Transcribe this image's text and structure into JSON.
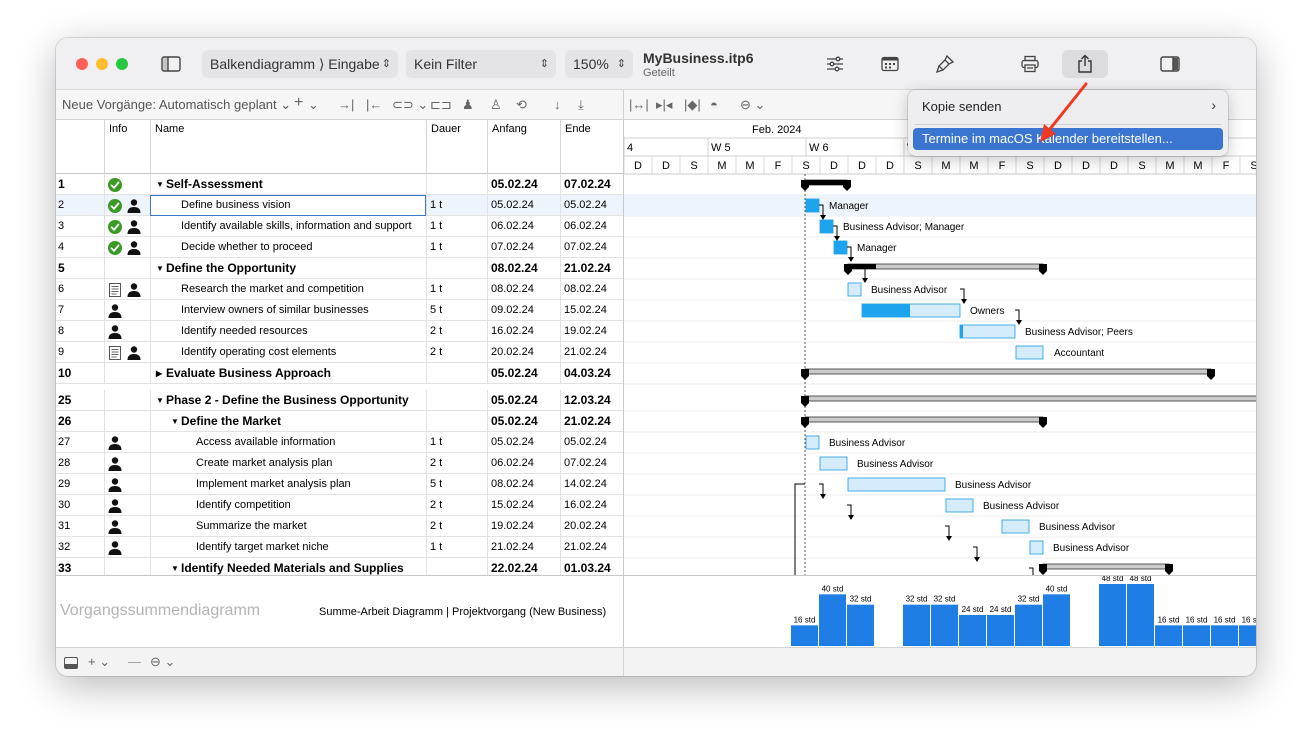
{
  "window": {
    "file_title": "MyBusiness.itp6",
    "file_subtitle": "Geteilt"
  },
  "toolbar": {
    "view_select": "Balkendiagramm ⟩ Eingabe",
    "filter_select": "Kein Filter",
    "zoom_select": "150%"
  },
  "toolbar2": {
    "new_tasks_label": "Neue Vorgänge: Automatisch geplant"
  },
  "share_menu": {
    "item_send_copy": "Kopie senden",
    "item_calendar": "Termine im macOS Kalender bereitstellen..."
  },
  "columns": {
    "info": "Info",
    "name": "Name",
    "duration": "Dauer",
    "start": "Anfang",
    "end": "Ende"
  },
  "timeline": {
    "month": "Feb. 2024",
    "weeks": [
      "4",
      "W 5",
      "W 6",
      "W"
    ],
    "days": [
      "D",
      "D",
      "S",
      "M",
      "M",
      "F",
      "S",
      "D",
      "D",
      "D",
      "S",
      "M",
      "M",
      "F",
      "S",
      "D",
      "D",
      "D",
      "S",
      "M",
      "M",
      "F",
      "S",
      "D",
      "D"
    ]
  },
  "rows": [
    {
      "id": "1",
      "info": [
        "check"
      ],
      "name": "Self-Assessment",
      "dur": "",
      "start": "05.02.24",
      "end": "07.02.24",
      "level": 0,
      "summary": true,
      "expanded": true
    },
    {
      "id": "2",
      "info": [
        "check",
        "person"
      ],
      "name": "Define business vision",
      "dur": "1 t",
      "start": "05.02.24",
      "end": "05.02.24",
      "level": 1,
      "summary": false,
      "selected": true
    },
    {
      "id": "3",
      "info": [
        "check",
        "person"
      ],
      "name": "Identify available skills, information and support",
      "dur": "1 t",
      "start": "06.02.24",
      "end": "06.02.24",
      "level": 1,
      "summary": false
    },
    {
      "id": "4",
      "info": [
        "check",
        "person"
      ],
      "name": "Decide whether to proceed",
      "dur": "1 t",
      "start": "07.02.24",
      "end": "07.02.24",
      "level": 1,
      "summary": false
    },
    {
      "id": "5",
      "info": [],
      "name": "Define the Opportunity",
      "dur": "",
      "start": "08.02.24",
      "end": "21.02.24",
      "level": 0,
      "summary": true,
      "expanded": true
    },
    {
      "id": "6",
      "info": [
        "note",
        "person"
      ],
      "name": "Research the market and competition",
      "dur": "1 t",
      "start": "08.02.24",
      "end": "08.02.24",
      "level": 1,
      "summary": false
    },
    {
      "id": "7",
      "info": [
        "person"
      ],
      "name": "Interview owners of similar businesses",
      "dur": "5 t",
      "start": "09.02.24",
      "end": "15.02.24",
      "level": 1,
      "summary": false
    },
    {
      "id": "8",
      "info": [
        "person"
      ],
      "name": "Identify needed resources",
      "dur": "2 t",
      "start": "16.02.24",
      "end": "19.02.24",
      "level": 1,
      "summary": false
    },
    {
      "id": "9",
      "info": [
        "note",
        "person"
      ],
      "name": "Identify operating cost elements",
      "dur": "2 t",
      "start": "20.02.24",
      "end": "21.02.24",
      "level": 1,
      "summary": false
    },
    {
      "id": "10",
      "info": [],
      "name": "Evaluate Business Approach",
      "dur": "",
      "start": "05.02.24",
      "end": "04.03.24",
      "level": 0,
      "summary": true,
      "expanded": false
    },
    {
      "id": "25",
      "info": [],
      "name": "Phase 2 - Define the Business Opportunity",
      "dur": "",
      "start": "05.02.24",
      "end": "12.03.24",
      "level": 0,
      "summary": true,
      "expanded": true
    },
    {
      "id": "26",
      "info": [],
      "name": "Define the Market",
      "dur": "",
      "start": "05.02.24",
      "end": "21.02.24",
      "level": 1,
      "summary": true,
      "expanded": true
    },
    {
      "id": "27",
      "info": [
        "person"
      ],
      "name": "Access available information",
      "dur": "1 t",
      "start": "05.02.24",
      "end": "05.02.24",
      "level": 2,
      "summary": false
    },
    {
      "id": "28",
      "info": [
        "person"
      ],
      "name": "Create market analysis plan",
      "dur": "2 t",
      "start": "06.02.24",
      "end": "07.02.24",
      "level": 2,
      "summary": false
    },
    {
      "id": "29",
      "info": [
        "person"
      ],
      "name": "Implement market analysis plan",
      "dur": "5 t",
      "start": "08.02.24",
      "end": "14.02.24",
      "level": 2,
      "summary": false
    },
    {
      "id": "30",
      "info": [
        "person"
      ],
      "name": "Identify competition",
      "dur": "2 t",
      "start": "15.02.24",
      "end": "16.02.24",
      "level": 2,
      "summary": false
    },
    {
      "id": "31",
      "info": [
        "person"
      ],
      "name": "Summarize the market",
      "dur": "2 t",
      "start": "19.02.24",
      "end": "20.02.24",
      "level": 2,
      "summary": false
    },
    {
      "id": "32",
      "info": [
        "person"
      ],
      "name": "Identify target market niche",
      "dur": "1 t",
      "start": "21.02.24",
      "end": "21.02.24",
      "level": 2,
      "summary": false
    },
    {
      "id": "33",
      "info": [],
      "name": "Identify Needed Materials and Supplies",
      "dur": "",
      "start": "22.02.24",
      "end": "01.03.24",
      "level": 1,
      "summary": true,
      "expanded": true
    }
  ],
  "gantt": {
    "resource_labels": {
      "r2": "Manager",
      "r3": "Business Advisor; Manager",
      "r4": "Manager",
      "r6": "Business Advisor",
      "r7": "Owners",
      "r8": "Business Advisor; Peers",
      "r9": "Accountant",
      "r27": "Business Advisor",
      "r28": "Business Advisor",
      "r29": "Business Advisor",
      "r30": "Business Advisor",
      "r31": "Business Advisor",
      "r32": "Business Advisor"
    }
  },
  "summary_panel": {
    "title": "Vorgangssummendiagramm",
    "subtitle": "Summe-Arbeit Diagramm | Projektvorgang (New Business)"
  },
  "chart_data": {
    "type": "bar",
    "labels": [
      "16 std",
      "40 std",
      "32 std",
      "",
      "32 std",
      "32 std",
      "24 std",
      "24 std",
      "32 std",
      "40 std",
      "",
      "48 std",
      "48 std",
      "16 std",
      "16 std",
      "16 std",
      "16 std"
    ],
    "values": [
      16,
      40,
      32,
      0,
      32,
      32,
      24,
      24,
      32,
      40,
      0,
      48,
      48,
      16,
      16,
      16,
      16
    ],
    "unit": "std"
  }
}
